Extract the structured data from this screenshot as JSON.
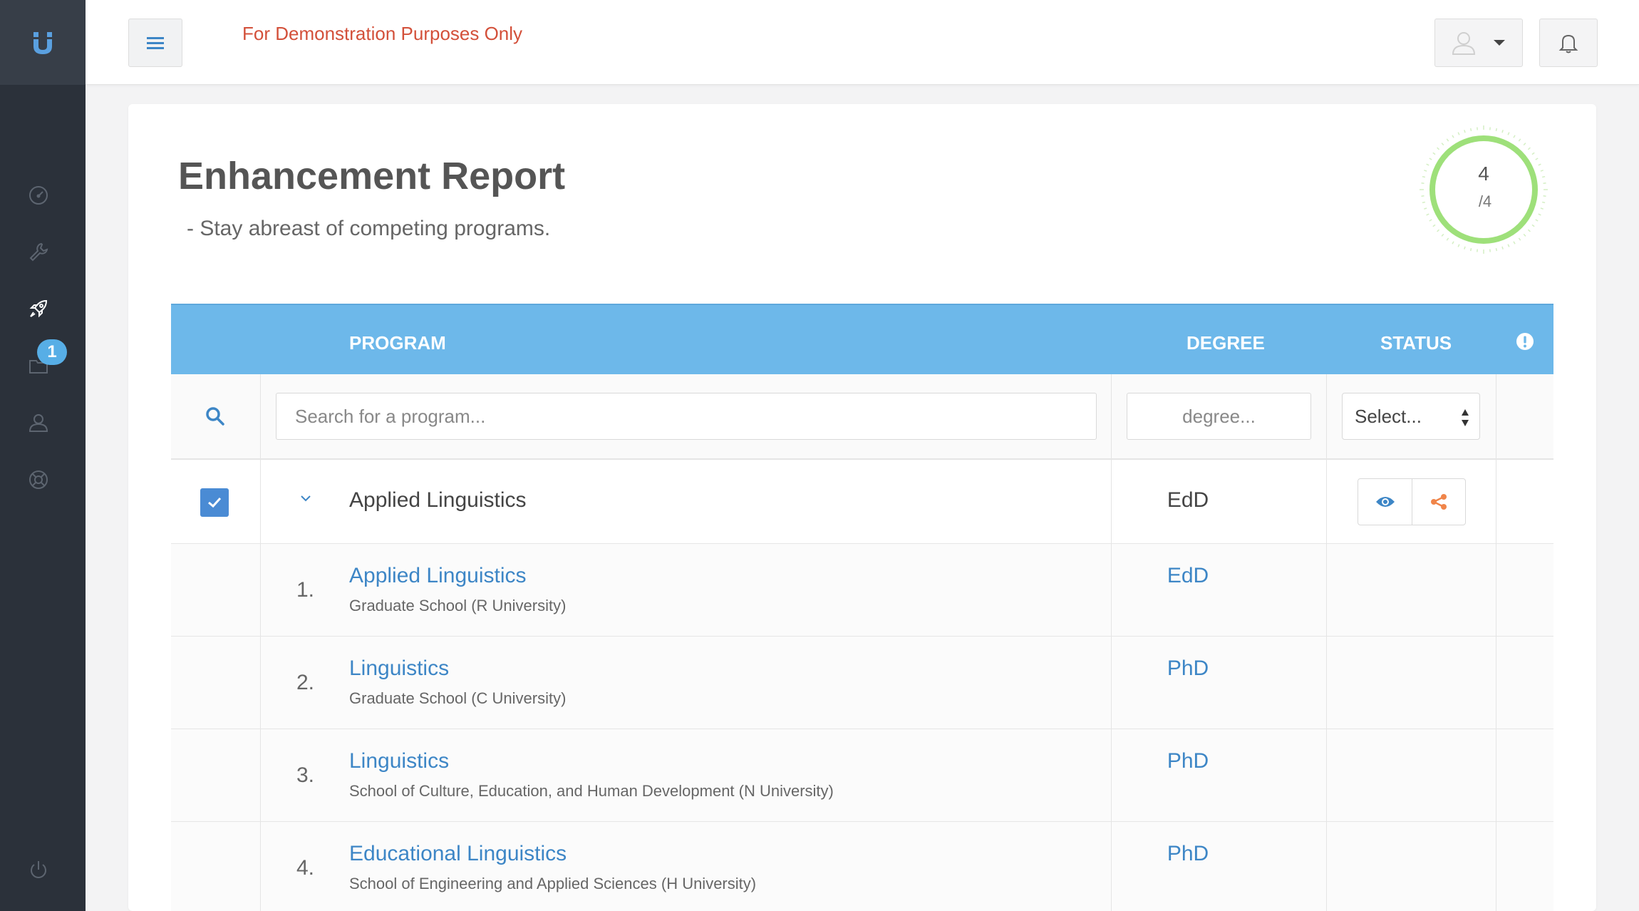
{
  "app": {
    "logo": "u-logo-icon"
  },
  "sidebar": {
    "items": [
      {
        "icon": "speedometer-icon"
      },
      {
        "icon": "wrench-icon"
      },
      {
        "icon": "rocket-icon",
        "active": true
      },
      {
        "icon": "folder-icon",
        "badge": "1"
      },
      {
        "icon": "user-icon"
      },
      {
        "icon": "lifebuoy-icon"
      },
      {
        "icon": "power-icon"
      }
    ]
  },
  "header": {
    "demo_text": "For Demonstration Purposes Only",
    "menu_icon": "hamburger-icon",
    "user_icon": "user-avatar-icon",
    "bell_icon": "bell-icon"
  },
  "page": {
    "title": "Enhancement Report",
    "subtitle": "- Stay abreast of competing programs.",
    "progress": {
      "count": "4",
      "total": "/4",
      "fraction": 1.0
    }
  },
  "table": {
    "headers": {
      "program": "PROGRAM",
      "degree": "DEGREE",
      "status": "STATUS"
    },
    "filters": {
      "program_placeholder": "Search for a program...",
      "degree_placeholder": "degree...",
      "status_value": "Select..."
    },
    "group": {
      "name": "Applied Linguistics",
      "degree": "EdD",
      "checked": true
    },
    "rows": [
      {
        "num": "1.",
        "program": "Applied Linguistics",
        "school": "Graduate School (R University)",
        "degree": "EdD"
      },
      {
        "num": "2.",
        "program": "Linguistics",
        "school": "Graduate School (C University)",
        "degree": "PhD"
      },
      {
        "num": "3.",
        "program": "Linguistics",
        "school": "School of Culture, Education, and Human Development (N University)",
        "degree": "PhD"
      },
      {
        "num": "4.",
        "program": "Educational Linguistics",
        "school": "School of Engineering and Applied Sciences (H University)",
        "degree": "PhD"
      }
    ]
  },
  "colors": {
    "sidebar": "#2b313a",
    "header_blue": "#6db8ea",
    "link_blue": "#3d86c6",
    "progress_green": "#9ee07a",
    "demo_red": "#d3503a",
    "share_orange": "#f0854a"
  }
}
